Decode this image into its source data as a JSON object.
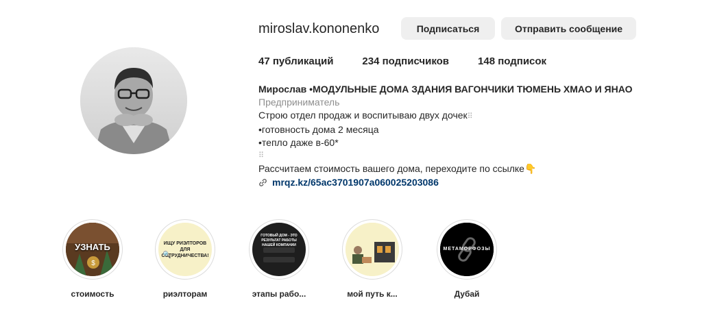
{
  "profile": {
    "username": "miroslav.kononenko",
    "follow_label": "Подписаться",
    "message_label": "Отправить сообщение",
    "stats": {
      "posts": "47 публикаций",
      "followers": "234 подписчиков",
      "following": "148 подписок"
    },
    "bio": {
      "full_name": "Мирослав •МОДУЛЬНЫЕ ДОМА ЗДАНИЯ ВАГОНЧИКИ ТЮМЕНЬ ХМАО И ЯНАО",
      "category": "Предприниматель",
      "line1": "Строю отдел продаж и воспитываю двух дочек",
      "line2": "•готовность дома 2 месяца",
      "line3": "•тепло даже в-60*",
      "line4": "Рассчитаем стоимость вашего дома, переходите по ссылке",
      "link": "mrqz.kz/65ac3701907a060025203086"
    }
  },
  "highlights": [
    {
      "label": "стоимость",
      "cover_text": "УЗНАТЬ"
    },
    {
      "label": "риэлторам",
      "cover_text": "ИЩУ РИЭЛТОРОВ ДЛЯ СОТРУДНИЧЕСТВА!"
    },
    {
      "label": "этапы рабо...",
      "cover_text": "ГОТОВЫЙ ДОМ - ЭТО РЕЗУЛЬТАТ РАБОТЫ НАШЕЙ КОМПАНИИ"
    },
    {
      "label": "мой путь к...",
      "cover_text": ""
    },
    {
      "label": "Дубай",
      "cover_text": "МЕТАМОРФОЗЫ"
    }
  ],
  "colors": {
    "button_bg": "#efefef",
    "link": "#00376b",
    "secondary_text": "#8e8e8e",
    "highlight_beige": "#f7f1c8"
  }
}
